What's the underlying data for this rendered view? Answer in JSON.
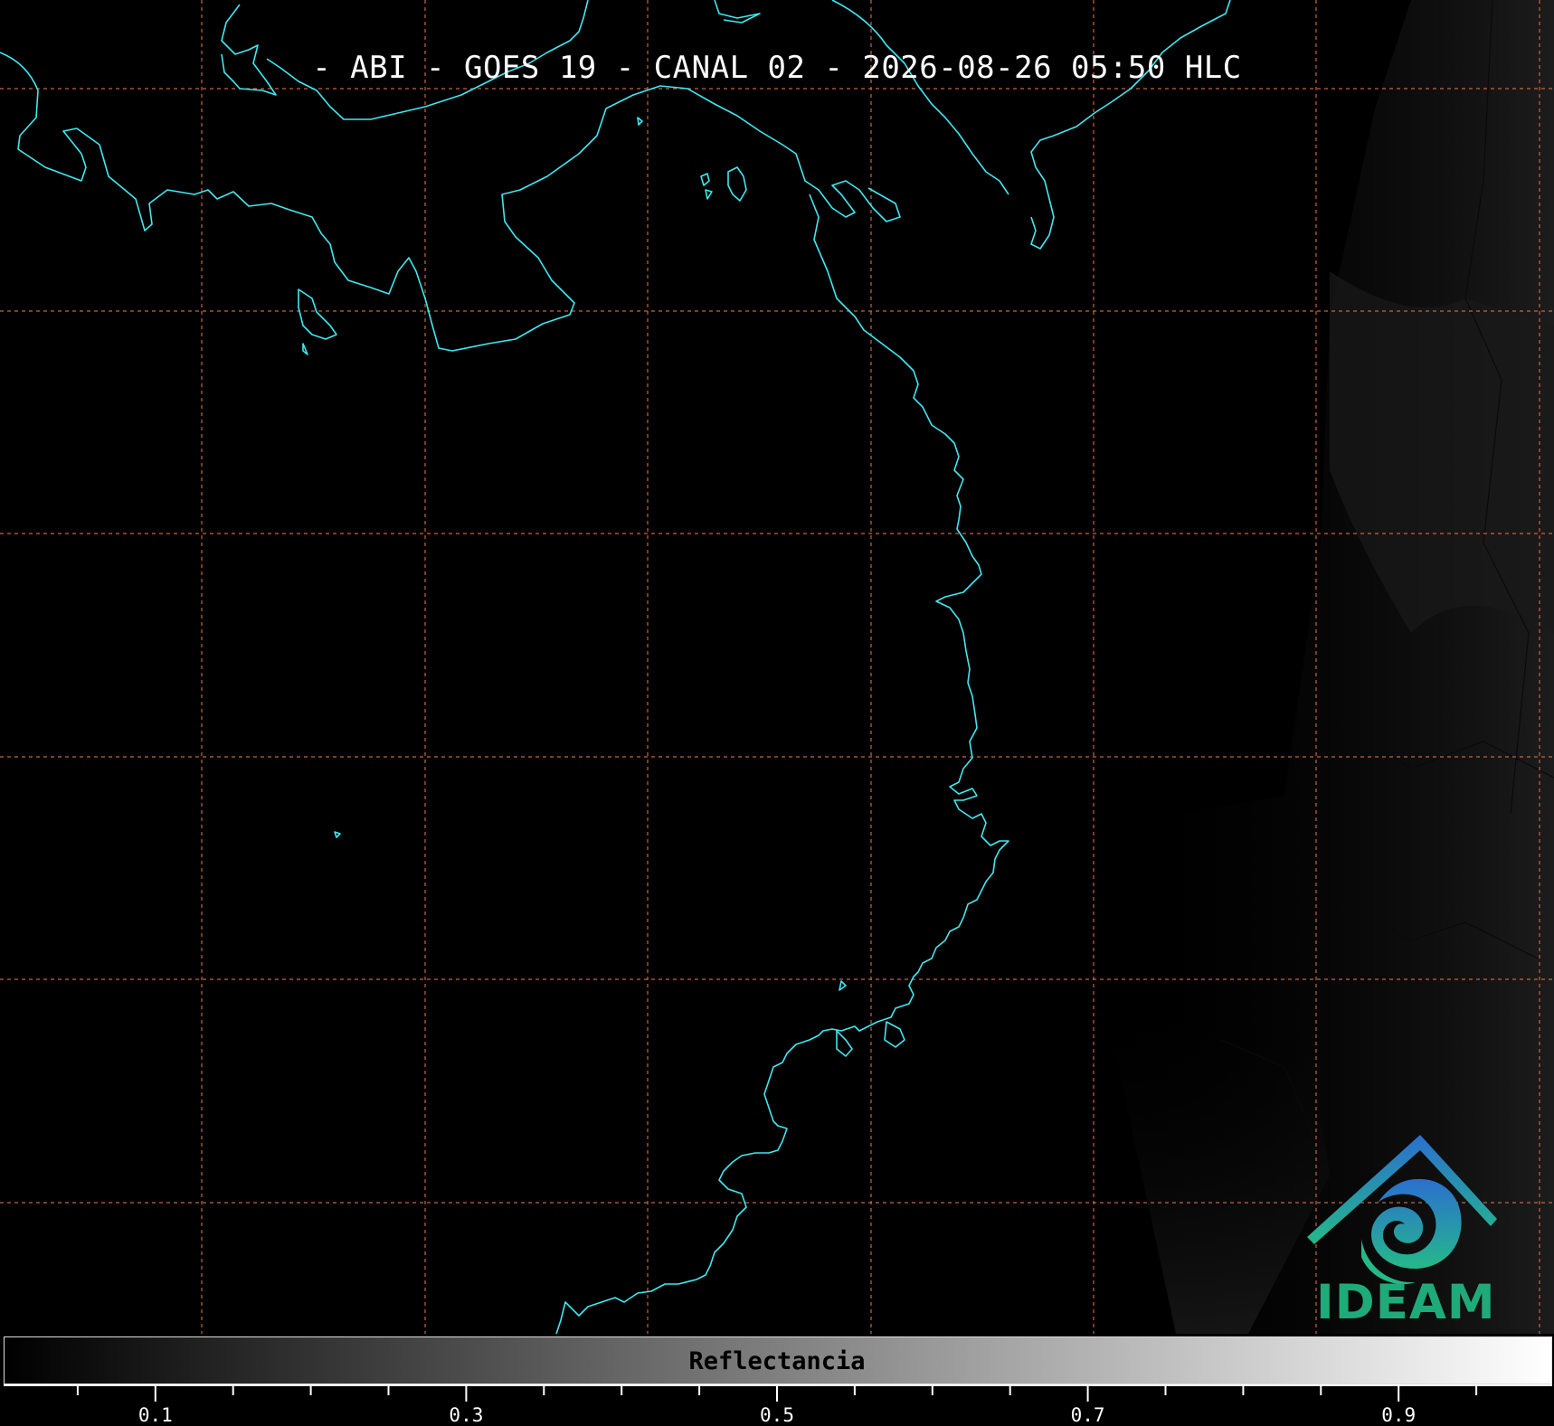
{
  "title": "- ABI - GOES 19 - CANAL 02 - 2026-08-26 05:50 HLC",
  "colorbar": {
    "label": "Reflectancia",
    "ticks": [
      "0.1",
      "0.3",
      "0.5",
      "0.7",
      "0.9"
    ],
    "range": [
      0.0,
      1.0
    ],
    "gradient": [
      "#000000",
      "#ffffff"
    ]
  },
  "logo": {
    "text": "IDEAM",
    "icon": "ideam-mountain-spiral-logo"
  },
  "colors": {
    "coastline": "#40e8f0",
    "graticule": "#c8643c",
    "background": "#000000"
  }
}
